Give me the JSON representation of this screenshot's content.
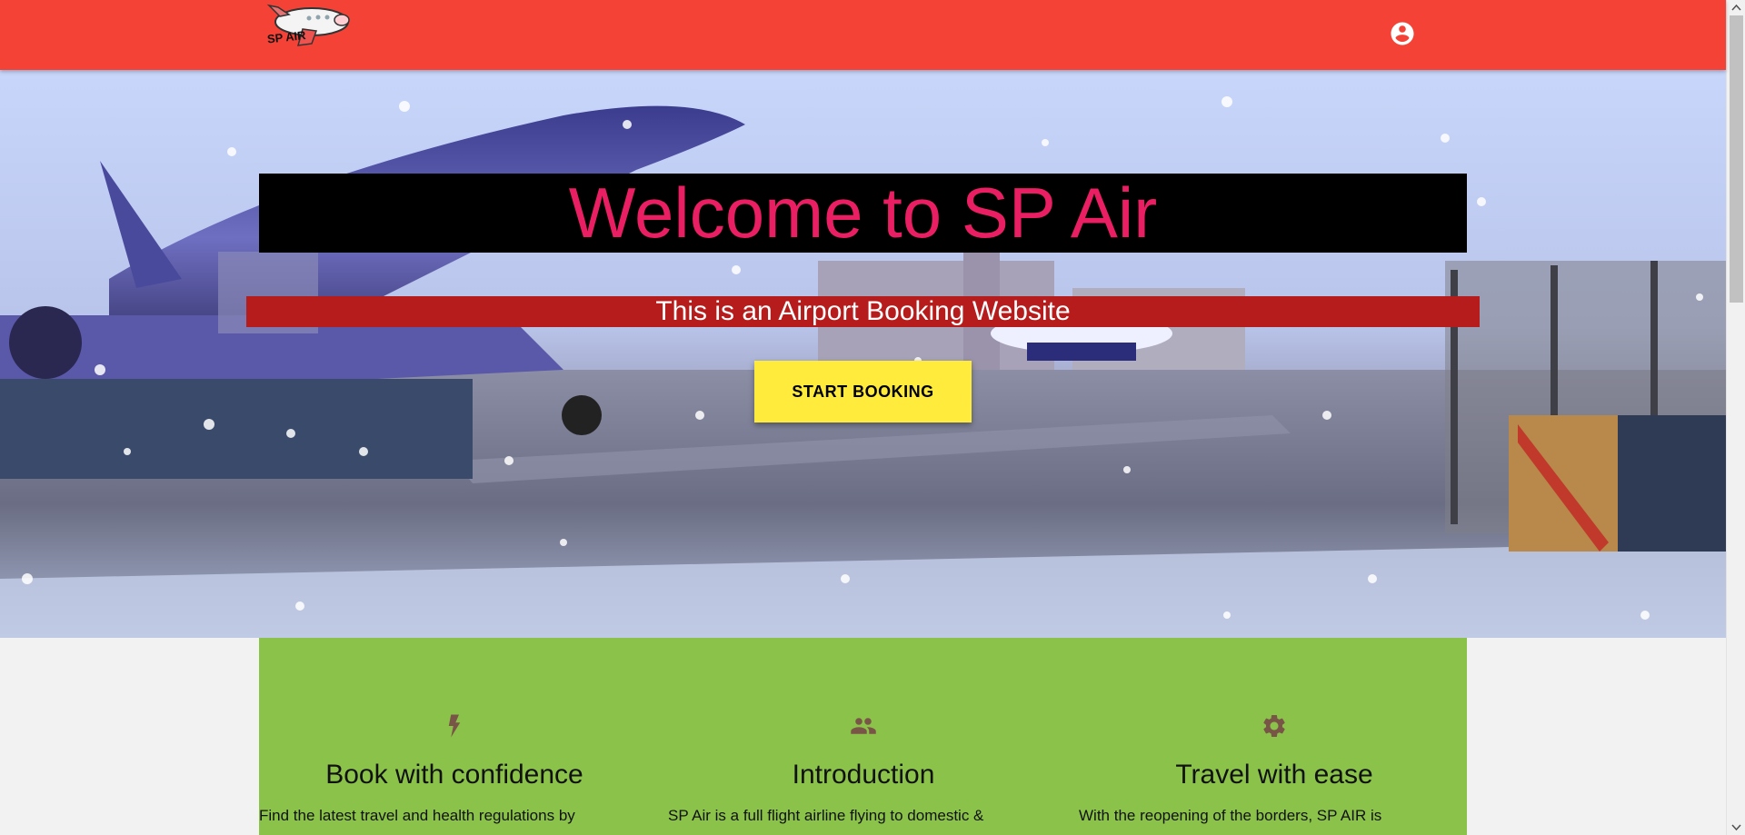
{
  "app": {
    "logo_text": "SP AIR",
    "colors": {
      "nav": "#f44336",
      "title_text": "#e91e63",
      "title_bg": "#000000",
      "subtitle_bg": "#b71c1c",
      "cta_bg": "#ffeb3b",
      "features_bg": "#8bc34a",
      "icon_color": "#795548"
    }
  },
  "header": {
    "account_icon": "account-circle-icon"
  },
  "hero": {
    "title": "Welcome to SP Air",
    "subtitle": "This is an Airport Booking Website",
    "cta_label": "START BOOKING"
  },
  "features": [
    {
      "icon": "bolt-icon",
      "title": "Book with confidence",
      "text": "Find the latest travel and health regulations by"
    },
    {
      "icon": "people-icon",
      "title": "Introduction",
      "text": "SP Air is a full flight airline flying to domestic &"
    },
    {
      "icon": "gear-icon",
      "title": "Travel with ease",
      "text": "With the reopening of the borders, SP AIR is"
    }
  ]
}
